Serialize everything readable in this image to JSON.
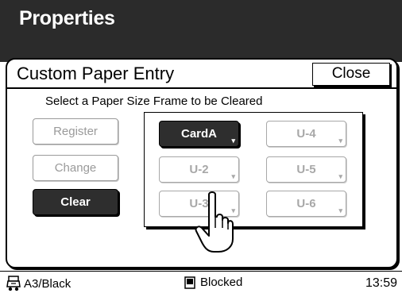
{
  "header": {
    "title": "Properties"
  },
  "dialog": {
    "title": "Custom Paper Entry",
    "close_label": "Close",
    "instruction": "Select a Paper Size Frame to be Cleared",
    "actions": [
      {
        "label": "Register",
        "state": "disabled"
      },
      {
        "label": "Change",
        "state": "disabled"
      },
      {
        "label": "Clear",
        "state": "active"
      }
    ],
    "slots": [
      {
        "label": "CardA",
        "state": "selected"
      },
      {
        "label": "U-4",
        "state": "empty"
      },
      {
        "label": "U-2",
        "state": "empty"
      },
      {
        "label": "U-5",
        "state": "empty"
      },
      {
        "label": "U-3",
        "state": "empty"
      },
      {
        "label": "U-6",
        "state": "empty"
      }
    ]
  },
  "status": {
    "paper": "A3/Black",
    "state": "Blocked",
    "time": "13:59",
    "printer_icon": "printer-icon",
    "blocked_icon": "document-icon"
  },
  "colors": {
    "titlebar": "#2b2b2b",
    "selected": "#2e2e2e",
    "disabled": "#9a9a9a"
  }
}
